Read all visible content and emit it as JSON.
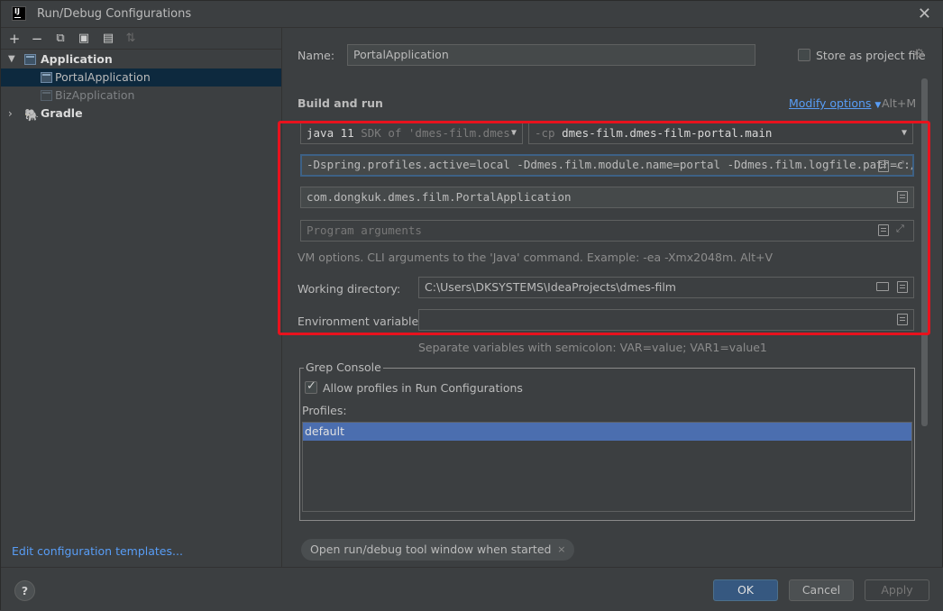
{
  "window": {
    "title": "Run/Debug Configurations",
    "app_icon": "IJ"
  },
  "toolbar": {
    "icons": [
      "plus-icon",
      "minus-icon",
      "copy-icon",
      "save-icon",
      "folder-add-icon",
      "sort-icon"
    ],
    "glyphs": {
      "plus": "+",
      "minus": "−",
      "copy": "⧉",
      "save": "▣",
      "folder": "▤",
      "sort": "⇅"
    }
  },
  "tree": {
    "application": "Application",
    "portal": "PortalApplication",
    "biz": "BizApplication",
    "gradle": "Gradle"
  },
  "left_footer": {
    "edit_templates": "Edit configuration templates..."
  },
  "form": {
    "name_label": "Name:",
    "name_value": "PortalApplication",
    "store_label": "Store as project file",
    "build_run": "Build and run",
    "modify_options": "Modify options",
    "modify_shortcut": "Alt+M",
    "sdk_main": "java 11",
    "sdk_sub": "SDK of 'dmes-film.dmes-",
    "cp_prefix": "-cp",
    "cp_value": "dmes-film.dmes-film-portal.main",
    "vm_options": "-Dspring.profiles.active=local -Ddmes.film.module.name=portal -Ddmes.film.logfile.path=c:/",
    "main_class": "com.dongkuk.dmes.film.PortalApplication",
    "program_args_placeholder": "Program arguments",
    "vm_hint": "VM options. CLI arguments to the 'Java' command. Example: -ea -Xmx2048m. Alt+V",
    "working_dir_label": "Working directory:",
    "working_dir_value": "C:\\Users\\DKSYSTEMS\\IdeaProjects\\dmes-film",
    "env_label": "Environment variables:",
    "env_value": "",
    "env_hint": "Separate variables with semicolon: VAR=value; VAR1=value1"
  },
  "grep": {
    "title": "Grep Console",
    "allow_label": "Allow profiles in Run Configurations",
    "allow_checked": true,
    "profiles_label": "Profiles:",
    "profiles": [
      "default"
    ]
  },
  "chip": {
    "label": "Open run/debug tool window when started",
    "close": "×"
  },
  "buttons": {
    "help": "?",
    "ok": "OK",
    "cancel": "Cancel",
    "apply": "Apply"
  }
}
